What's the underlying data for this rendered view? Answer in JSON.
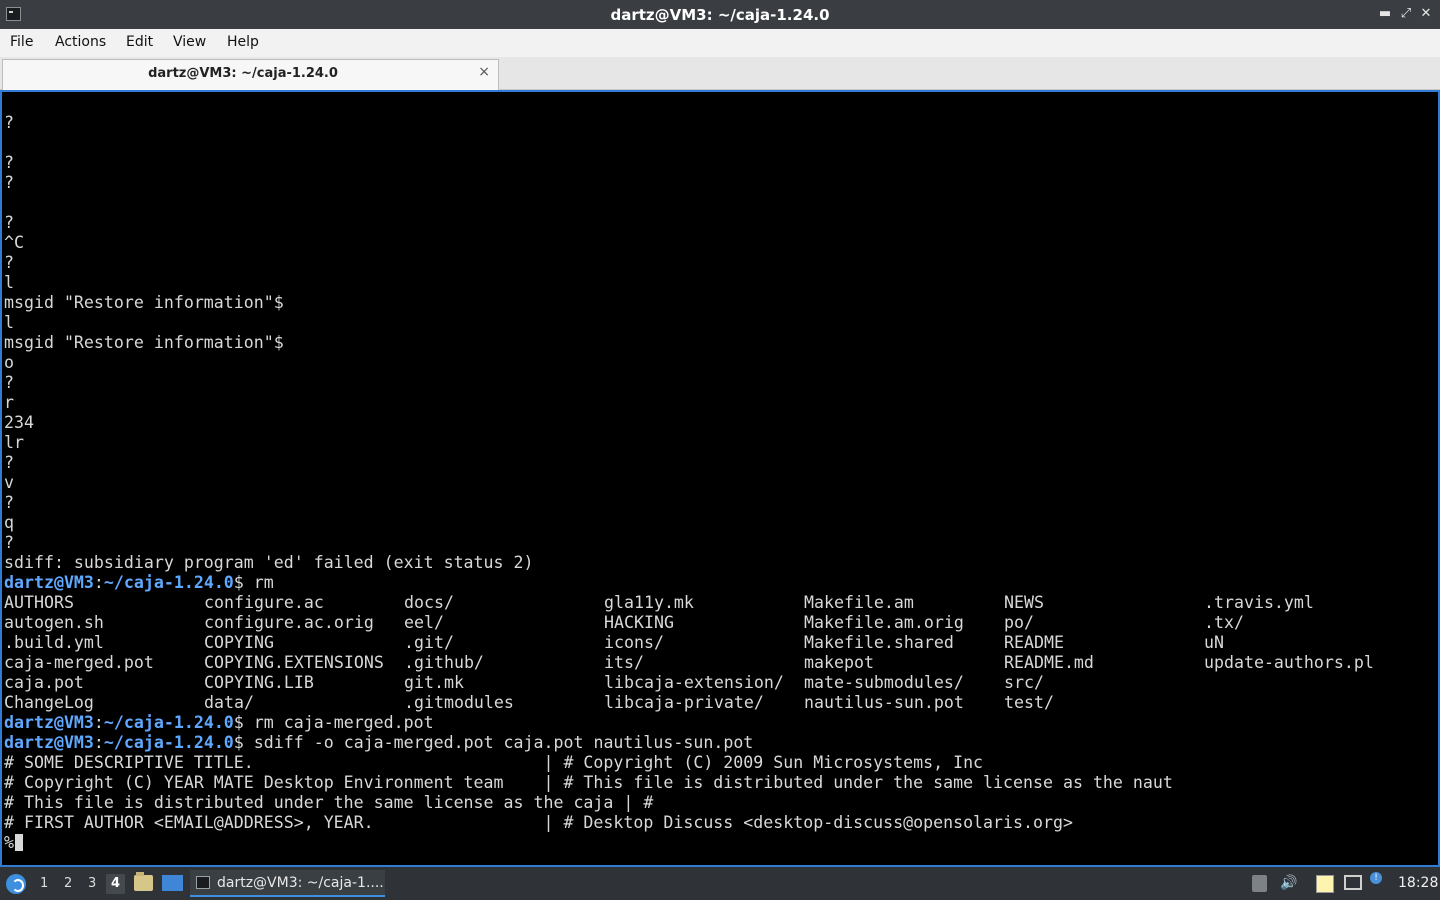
{
  "window": {
    "title": "dartz@VM3: ~/caja-1.24.0",
    "buttons": {
      "minimize": "▬",
      "maximize": "⤢",
      "close": "✕"
    }
  },
  "menubar": {
    "items": [
      "File",
      "Actions",
      "Edit",
      "View",
      "Help"
    ]
  },
  "tab": {
    "label": "dartz@VM3: ~/caja-1.24.0",
    "close": "×"
  },
  "terminal": {
    "lines": [
      "?",
      "",
      "?",
      "?",
      "",
      "?",
      "^C",
      "?",
      "l",
      "msgid \"Restore information\"$",
      "l",
      "msgid \"Restore information\"$",
      "o",
      "?",
      "r",
      "234",
      "lr",
      "?",
      "v",
      "?",
      "q",
      "?",
      "sdiff: subsidiary program 'ed' failed (exit status 2)"
    ],
    "prompt": {
      "user_host": "dartz@VM3",
      "sep": ":",
      "path": "~/caja-1.24.0",
      "sigil": "$"
    },
    "cmd_rm": " rm",
    "ls_columns": [
      [
        "AUTHORS",
        "autogen.sh",
        ".build.yml",
        "caja-merged.pot",
        "caja.pot",
        "ChangeLog"
      ],
      [
        "configure.ac",
        "configure.ac.orig",
        "COPYING",
        "COPYING.EXTENSIONS",
        "COPYING.LIB",
        "data/"
      ],
      [
        "docs/",
        "eel/",
        ".git/",
        ".github/",
        "git.mk",
        ".gitmodules"
      ],
      [
        "gla11y.mk",
        "HACKING",
        "icons/",
        "its/",
        "libcaja-extension/",
        "libcaja-private/"
      ],
      [
        "Makefile.am",
        "Makefile.am.orig",
        "Makefile.shared",
        "makepot",
        "mate-submodules/",
        "nautilus-sun.pot"
      ],
      [
        "NEWS",
        "po/",
        "README",
        "README.md",
        "src/",
        "test/"
      ],
      [
        ".travis.yml",
        ".tx/",
        "uN",
        "update-authors.pl",
        "",
        ""
      ]
    ],
    "cmd_rm_merged": " rm caja-merged.pot",
    "cmd_sdiff": " sdiff -o caja-merged.pot caja.pot nautilus-sun.pot",
    "sdiff_lines": [
      "# SOME DESCRIPTIVE TITLE.                             | # Copyright (C) 2009 Sun Microsystems, Inc",
      "# Copyright (C) YEAR MATE Desktop Environment team    | # This file is distributed under the same license as the naut",
      "# This file is distributed under the same license as the caja | #",
      "# FIRST AUTHOR <EMAIL@ADDRESS>, YEAR.                 | # Desktop Discuss <desktop-discuss@opensolaris.org>"
    ],
    "current_input": "%"
  },
  "taskbar": {
    "desktops": [
      "1",
      "2",
      "3",
      "4"
    ],
    "active_desktop": "4",
    "task_label": "dartz@VM3: ~/caja-1....",
    "volume_glyph": "🔊",
    "info_glyph": "!",
    "clock": "18:28"
  },
  "colors": {
    "terminal_bg": "#000000",
    "terminal_fg": "#d8d8d8",
    "prompt": "#5fa8ff",
    "accent": "#2f7bd6"
  }
}
